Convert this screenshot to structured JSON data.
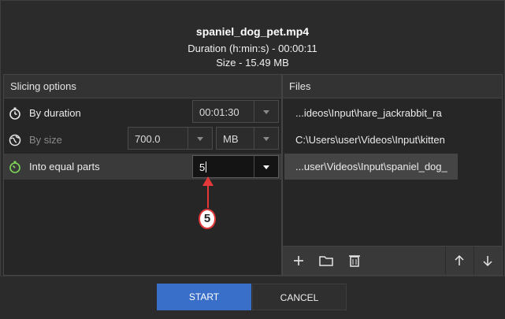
{
  "header": {
    "filename": "spaniel_dog_pet.mp4",
    "duration_line": "Duration (h:min:s) - 00:00:11",
    "size_line": "Size - 15.49 MB"
  },
  "slicing": {
    "title": "Slicing options",
    "by_duration": {
      "label": "By duration",
      "value": "00:01:30",
      "icon": "stopwatch-icon"
    },
    "by_size": {
      "label": "By size",
      "value": "700.0",
      "unit": "MB",
      "icon": "globe-icon"
    },
    "equal_parts": {
      "label": "Into equal parts",
      "value": "5",
      "icon": "stopwatch-icon"
    }
  },
  "files": {
    "title": "Files",
    "items": [
      "...ideos\\Input\\hare_jackrabbit_ra",
      "C:\\Users\\user\\Videos\\Input\\kitten",
      "...user\\Videos\\Input\\spaniel_dog_"
    ]
  },
  "toolbar": {
    "icons": [
      "plus-icon",
      "folder-icon",
      "trash-icon",
      "arrow-up-icon",
      "arrow-down-icon"
    ]
  },
  "buttons": {
    "start": "START",
    "cancel": "CANCEL"
  },
  "annotation": {
    "number": "5"
  },
  "colors": {
    "accent": "#3a6fc9",
    "annotation": "#e23838",
    "background": "#2b2b2b"
  }
}
